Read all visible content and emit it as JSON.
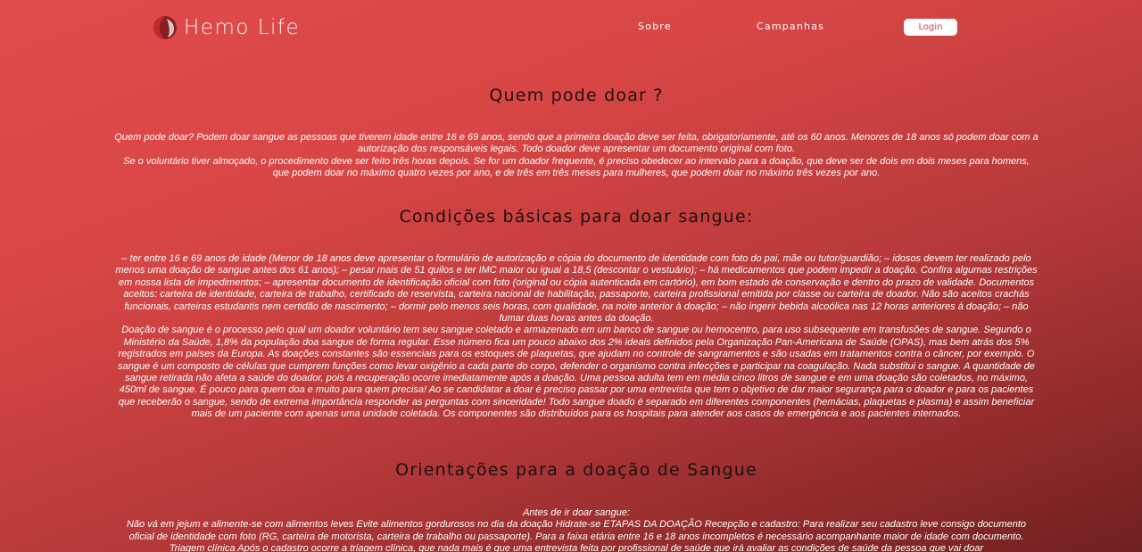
{
  "header": {
    "logo_text": "Hemo Life",
    "nav": {
      "sobre": "Sobre",
      "campanhas": "Campanhas",
      "login": "Login"
    }
  },
  "sections": [
    {
      "title": "Quem pode doar ?",
      "paragraphs": [
        "Quem pode doar? Podem doar sangue as pessoas que tiverem idade entre 16 e 69 anos, sendo que a primeira doação deve ser feita, obrigatoriamente, até os 60 anos. Menores de 18 anos só podem doar com a autorização dos responsáveis legais. Todo doador deve apresentar um documento original com foto.",
        "Se o voluntário tiver almoçado, o procedimento deve ser feito três horas depois. Se for um doador frequente, é preciso obedecer ao intervalo para a doação, que deve ser de dois em dois meses para homens, que podem doar no máximo quatro vezes por ano, e de três em três meses para mulheres, que podem doar no máximo três vezes por ano."
      ]
    },
    {
      "title": "Condições básicas para doar sangue:",
      "paragraphs": [
        "– ter entre 16 e 69 anos de idade (Menor de 18 anos deve apresentar o formulário de autorização e cópia do documento de identidade com foto do pai, mãe ou tutor/guardião; – idosos devem ter realizado pelo menos uma doação de sangue antes dos 61 anos); – pesar mais de 51 quilos e ter IMC maior ou igual a 18,5 (descontar o vestuário); – há medicamentos que podem impedir a doação. Confira algumas restrições em nossa lista de impedimentos; – apresentar documento de identificação oficial com foto (original ou cópia autenticada em cartório), em bom estado de conservação e dentro do prazo de validade. Documentos aceitos: carteira de identidade, carteira de trabalho, certificado de reservista, carteira nacional de habilitação, passaporte, carteira profissional emitida por classe ou carteira de doador. Não são aceitos crachás funcionais, carteiras estudantis nem certidão de nascimento; – dormir pelo menos seis horas, com qualidade, na noite anterior à doação; – não ingerir bebida alcoólica nas 12 horas anteriores à doação; – não fumar duas horas antes da doação.",
        "Doação de sangue é o processo pelo qual um doador voluntário tem seu sangue coletado e armazenado em um banco de sangue ou hemocentro, para uso subsequente em transfusões de sangue. Segundo o Ministério da Saúde, 1,8% da população doa sangue de forma regular. Esse número fica um pouco abaixo dos 2% ideais definidos pela Organização Pan-Americana de Saúde (OPAS), mas bem atrás dos 5% registrados em países da Europa. As doações constantes são essenciais para os estoques de plaquetas, que ajudam no controle de sangramentos e são usadas em tratamentos contra o câncer, por exemplo. O sangue é um composto de células que cumprem funções como levar oxigênio a cada parte do corpo, defender o organismo contra infecções e participar na coagulação. Nada substitui o sangue. A quantidade de sangue retirada não afeta a saúde do doador, pois a recuperação ocorre imediatamente após a doação. Uma pessoa adulta tem em média cinco litros de sangue e em uma doação são coletados, no máximo, 450ml de sangue. É pouco para quem doa e muito para quem precisa! Ao se candidatar a doar é preciso passar por uma entrevista que tem o objetivo de dar maior segurança para o doador e para os pacientes que receberão o sangue, sendo de extrema importância responder as perguntas com sinceridade! Todo sangue doado é separado em diferentes componentes (hemácias, plaquetas e plasma) e assim beneficiar mais de um paciente com apenas uma unidade coletada. Os componentes são distribuídos para os hospitais para atender aos casos de emergência e aos pacientes internados."
      ]
    },
    {
      "title": "Orientações para a doação de Sangue",
      "paragraphs": [
        "Antes de ir doar sangue:",
        "Não vá em jejum e alimente-se com alimentos leves Evite alimentos gordurosos no dia da doação Hidrate-se ETAPAS DA DOAÇÃO Recepção e cadastro: Para realizar seu cadastro leve consigo documento oficial de identidade com foto (RG, carteira de motorista, carteira de trabalho ou passaporte). Para a faixa etária entre 16 e 18 anos incompletos é necessário acompanhante maior de idade com documento. Triagem clínica Após o cadastro ocorre a triagem clínica, que nada mais é que uma entrevista feita por profissional de saúde que irá avaliar as condições de saúde da pessoa que vai doar"
      ]
    }
  ],
  "colors": {
    "background_start": "#e04b4b",
    "background_end": "#6e2020",
    "title_color": "#1c1010",
    "text_color": "#ffffff",
    "login_text": "#c94545"
  }
}
